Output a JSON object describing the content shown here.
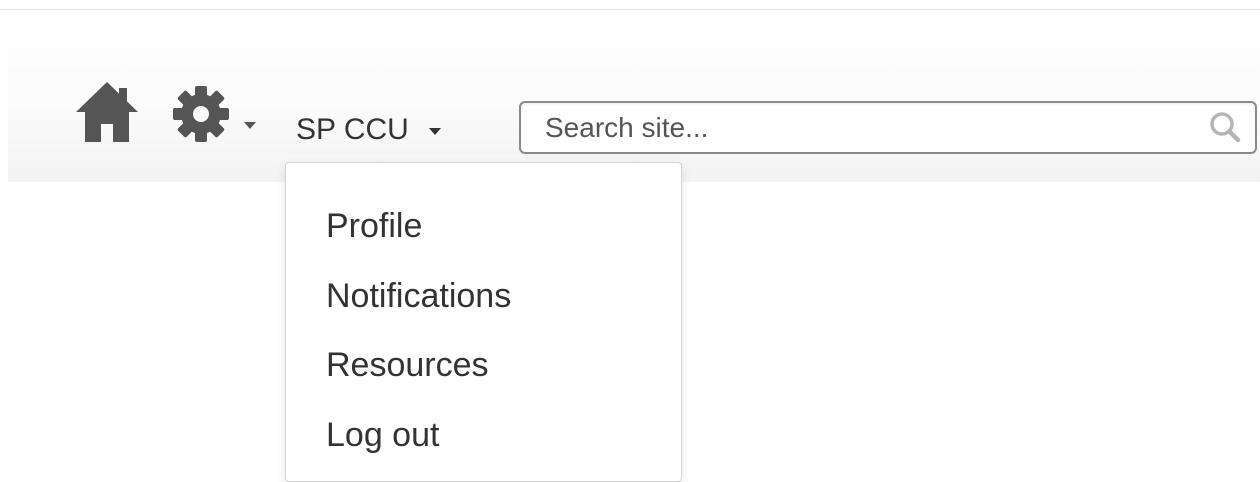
{
  "navbar": {
    "home_icon": "home-icon",
    "settings_icon": "gear-icon",
    "user_menu": {
      "label": "SP CCU",
      "items": [
        {
          "label": "Profile"
        },
        {
          "label": "Notifications"
        },
        {
          "label": "Resources"
        },
        {
          "label": "Log out"
        }
      ]
    },
    "search": {
      "placeholder": "Search site...",
      "value": "",
      "icon": "search-icon"
    }
  },
  "colors": {
    "text": "#333333",
    "icon": "#555555",
    "navbar_bg": "#f8f8f8",
    "input_border": "#8a8a8a"
  }
}
